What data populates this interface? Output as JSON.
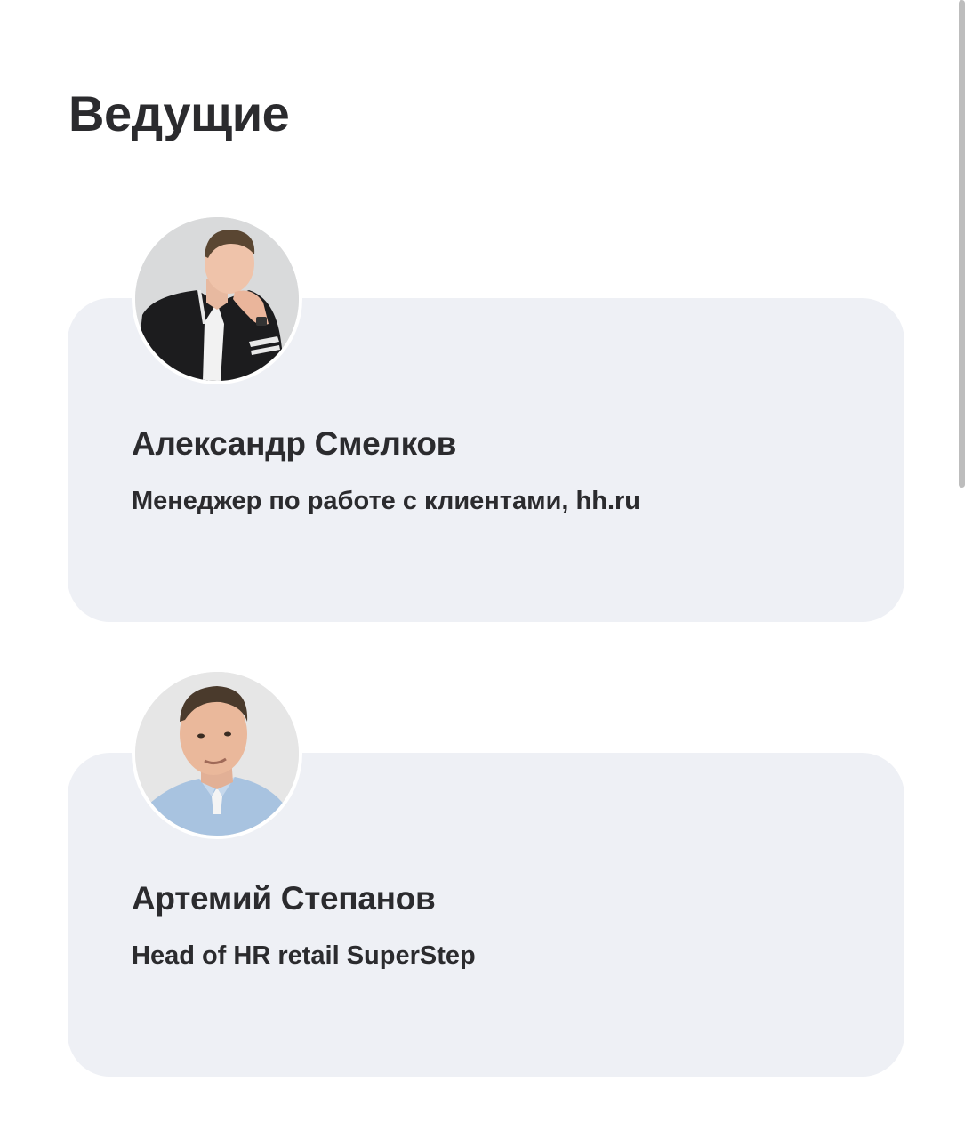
{
  "section": {
    "title": "Ведущие"
  },
  "hosts": [
    {
      "name": "Александр Смелков",
      "role": "Менеджер по работе с клиентами, hh.ru"
    },
    {
      "name": "Артемий Степанов",
      "role": "Head of HR retail SuperStep"
    }
  ],
  "colors": {
    "card_background": "#eef0f5",
    "text": "#2b2b2e",
    "page_background": "#ffffff"
  }
}
